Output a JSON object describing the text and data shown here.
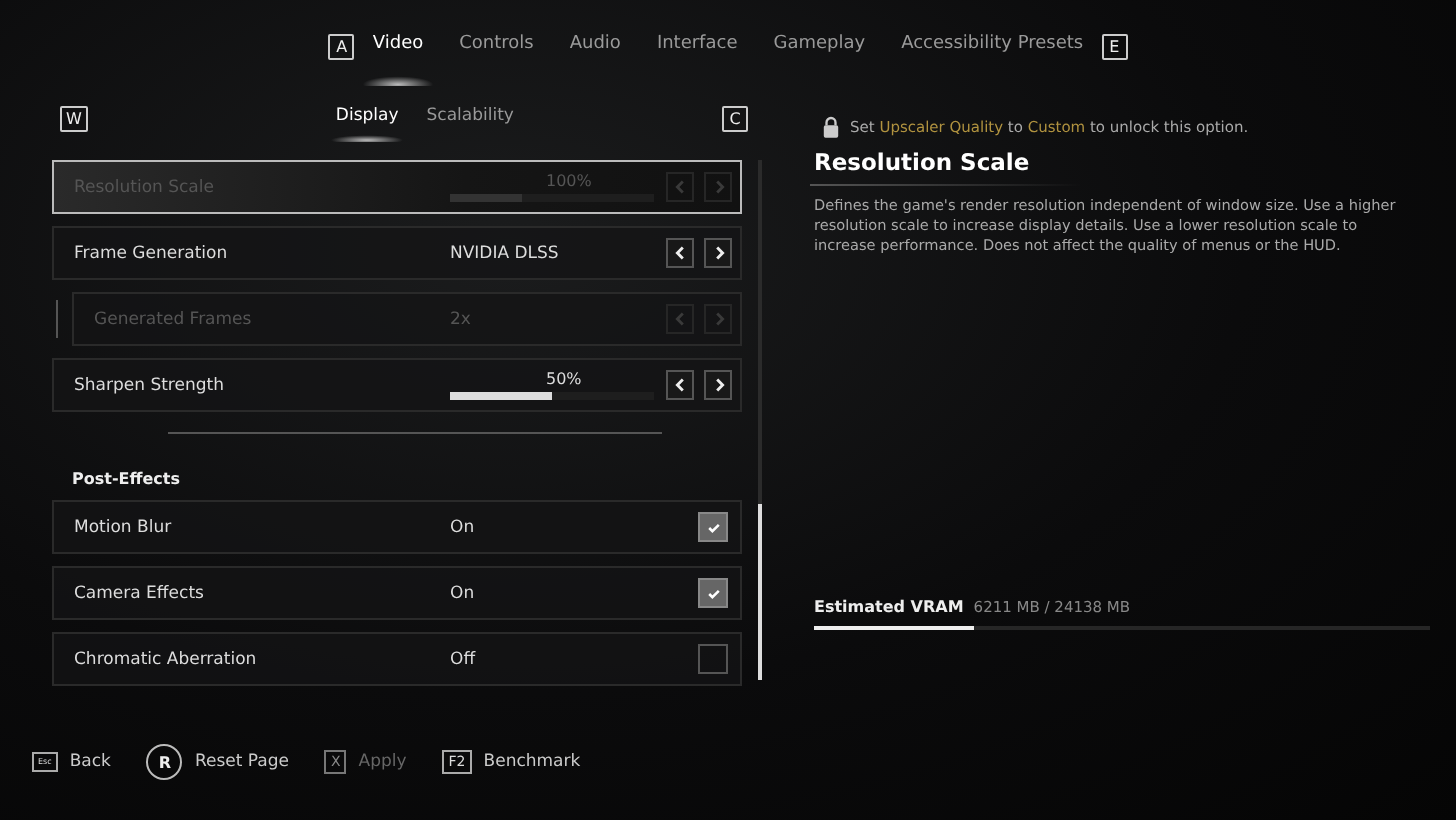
{
  "top_tabs": {
    "prev_key": "A",
    "next_key": "E",
    "items": [
      {
        "label": "Video",
        "selected": true
      },
      {
        "label": "Controls",
        "selected": false
      },
      {
        "label": "Audio",
        "selected": false
      },
      {
        "label": "Interface",
        "selected": false
      },
      {
        "label": "Gameplay",
        "selected": false
      },
      {
        "label": "Accessibility Presets",
        "selected": false
      }
    ]
  },
  "sub_tabs": {
    "prev_key": "W",
    "next_key": "C",
    "items": [
      {
        "label": "Display",
        "selected": true
      },
      {
        "label": "Scalability",
        "selected": false
      }
    ]
  },
  "settings": [
    {
      "kind": "slider",
      "label": "Resolution Scale",
      "value": "100%",
      "level": 0.35,
      "disabled": true,
      "selected": true,
      "nested": false
    },
    {
      "kind": "selector",
      "label": "Frame Generation",
      "value": "NVIDIA DLSS",
      "disabled": false,
      "selected": false,
      "nested": false
    },
    {
      "kind": "selector",
      "label": "Generated Frames",
      "value": "2x",
      "disabled": true,
      "selected": false,
      "nested": true
    },
    {
      "kind": "slider",
      "label": "Sharpen Strength",
      "value": "50%",
      "level": 0.5,
      "disabled": false,
      "selected": false,
      "nested": false
    },
    {
      "kind": "divider"
    },
    {
      "kind": "heading",
      "label": "Post-Effects"
    },
    {
      "kind": "toggle",
      "label": "Motion Blur",
      "value": "On",
      "checked": true,
      "disabled": false,
      "selected": false,
      "nested": false
    },
    {
      "kind": "toggle",
      "label": "Camera Effects",
      "value": "On",
      "checked": true,
      "disabled": false,
      "selected": false,
      "nested": false
    },
    {
      "kind": "toggle",
      "label": "Chromatic Aberration",
      "value": "Off",
      "checked": false,
      "disabled": false,
      "selected": false,
      "nested": false
    }
  ],
  "details": {
    "lock_note": [
      {
        "text": "Set ",
        "highlight": false
      },
      {
        "text": "Upscaler Quality",
        "highlight": true
      },
      {
        "text": " to ",
        "highlight": false
      },
      {
        "text": "Custom",
        "highlight": true
      },
      {
        "text": " to unlock this option.",
        "highlight": false
      }
    ],
    "title": "Resolution Scale",
    "description": "Defines the game's render resolution independent of window size. Use a higher resolution scale to increase display details. Use a lower resolution scale to increase performance. Does not affect the quality of menus or the HUD."
  },
  "vram": {
    "label": "Estimated VRAM",
    "reading": "6211 MB / 24138 MB",
    "level": 0.26
  },
  "footer": [
    {
      "kind": "keycap",
      "key": "Esc",
      "label": "Back",
      "disabled": false
    },
    {
      "kind": "circle",
      "key": "R",
      "label": "Reset Page",
      "disabled": false
    },
    {
      "kind": "keycap",
      "key": "X",
      "label": "Apply",
      "disabled": true
    },
    {
      "kind": "keycap",
      "key": "F2",
      "label": "Benchmark",
      "disabled": false
    }
  ]
}
